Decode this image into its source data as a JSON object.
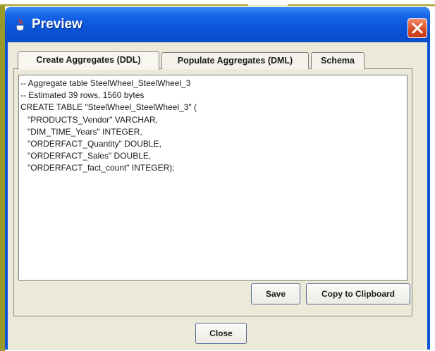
{
  "window": {
    "title": "Preview",
    "title_icon": "java-coffee-icon",
    "close_icon": "close-icon"
  },
  "tabs": [
    {
      "label": "Create Aggregates (DDL)",
      "active": true
    },
    {
      "label": "Populate Aggregates (DML)",
      "active": false
    },
    {
      "label": "Schema",
      "active": false
    }
  ],
  "content": {
    "lines": [
      "-- Aggregate table SteelWheel_SteelWheel_3",
      "-- Estimated 39 rows, 1560 bytes",
      "CREATE TABLE \"SteelWheel_SteelWheel_3\" (",
      "   \"PRODUCTS_Vendor\" VARCHAR,",
      "   \"DIM_TIME_Years\" INTEGER,",
      "   \"ORDERFACT_Quantity\" DOUBLE,",
      "   \"ORDERFACT_Sales\" DOUBLE,",
      "   \"ORDERFACT_fact_count\" INTEGER);"
    ]
  },
  "buttons": {
    "save": "Save",
    "copy": "Copy to Clipboard",
    "close": "Close"
  },
  "colors": {
    "titlebar": "#0a53d8",
    "client_bg": "#ece9d8",
    "close_button": "#d84a20"
  }
}
